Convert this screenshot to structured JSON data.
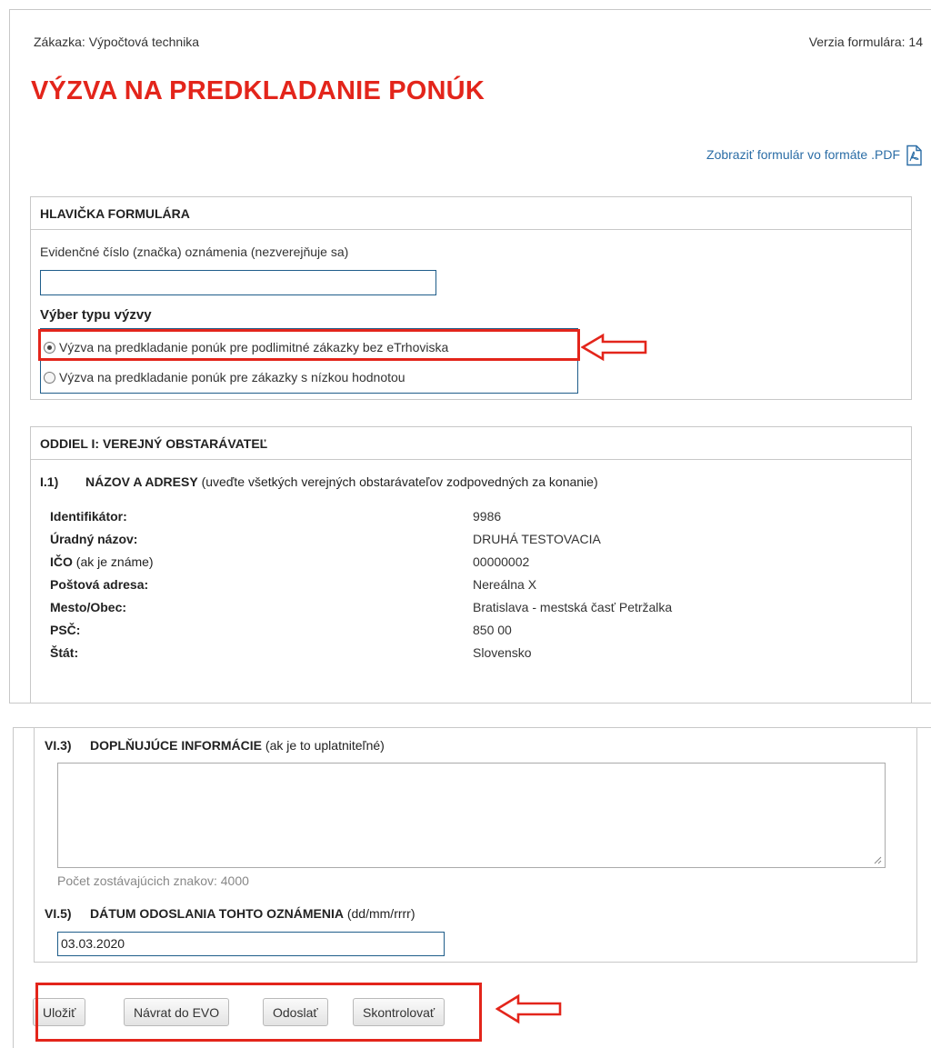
{
  "header": {
    "contract_label": "Zákazka: Výpočtová technika",
    "form_version": "Verzia formulára: 14",
    "title": "VÝZVA NA PREDKLADANIE PONÚK",
    "pdf_link": "Zobraziť formulár vo formáte .PDF"
  },
  "form_header": {
    "heading": "HLAVIČKA FORMULÁRA",
    "evidence_label": "Evidenčné číslo (značka) oznámenia (nezverejňuje sa)",
    "evidence_value": "",
    "call_type_label": "Výber typu výzvy",
    "options": [
      {
        "label": "Výzva na predkladanie ponúk pre podlimitné zákazky bez eTrhoviska",
        "selected": true
      },
      {
        "label": "Výzva na predkladanie ponúk pre zákazky s nízkou hodnotou",
        "selected": false
      }
    ]
  },
  "section1": {
    "heading": "ODDIEL I: VEREJNÝ OBSTARÁVATEĽ",
    "sub_number": "I.1)",
    "sub_title": "NÁZOV A ADRESY",
    "sub_note": " (uveďte všetkých verejných obstarávateľov zodpovedných za konanie)",
    "rows": [
      {
        "label": "Identifikátor:",
        "note": "",
        "value": "9986"
      },
      {
        "label": "Úradný názov:",
        "note": "",
        "value": "DRUHÁ TESTOVACIA"
      },
      {
        "label": "IČO",
        "note": " (ak je známe)",
        "value": "00000002"
      },
      {
        "label": "Poštová adresa:",
        "note": "",
        "value": "Nereálna X"
      },
      {
        "label": "Mesto/Obec:",
        "note": "",
        "value": "Bratislava - mestská časť Petržalka"
      },
      {
        "label": "PSČ:",
        "note": "",
        "value": "850 00"
      },
      {
        "label": "Štát:",
        "note": "",
        "value": "Slovensko"
      }
    ]
  },
  "section6": {
    "vi3_number": "VI.3)",
    "vi3_title": "DOPLŇUJÚCE INFORMÁCIE",
    "vi3_note": " (ak je to uplatniteľné)",
    "textarea_value": "",
    "counter": "Počet zostávajúcich znakov: 4000",
    "vi5_number": "VI.5)",
    "vi5_title": "DÁTUM ODOSLANIA TOHTO OZNÁMENIA",
    "vi5_note": " (dd/mm/rrrr)",
    "date_value": "03.03.2020"
  },
  "actions": {
    "save": "Uložiť",
    "back": "Návrat do EVO",
    "send": "Odoslať",
    "check": "Skontrolovať"
  },
  "colors": {
    "title_red": "#e3251b",
    "link_blue": "#2b6da6",
    "input_border": "#1f5d8a"
  }
}
